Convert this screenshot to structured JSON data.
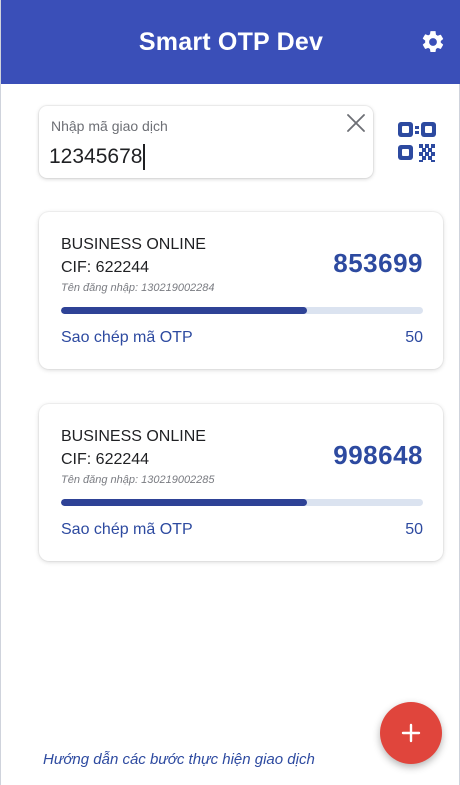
{
  "header": {
    "title": "Smart OTP Dev",
    "settings_icon": "gear-icon"
  },
  "transaction_input": {
    "label": "Nhập mã giao dịch",
    "value": "12345678",
    "clear_icon": "close-icon"
  },
  "qr_scanner": {
    "icon": "qr-code-icon"
  },
  "otp_cards": [
    {
      "service": "BUSINESS ONLINE",
      "cif": "CIF: 622244",
      "username": "Tên đăng nhập: 130219002284",
      "code": "853699",
      "copy_label": "Sao chép mã OTP",
      "seconds_left": "50",
      "progress_fraction": 0.68
    },
    {
      "service": "BUSINESS ONLINE",
      "cif": "CIF: 622244",
      "username": "Tên đăng nhập: 130219002285",
      "code": "998648",
      "copy_label": "Sao chép mã OTP",
      "seconds_left": "50",
      "progress_fraction": 0.68
    }
  ],
  "footer": {
    "guide_link": "Hướng dẫn các bước thực hiện giao dịch"
  },
  "fab": {
    "label": "+",
    "icon": "plus-icon"
  },
  "colors": {
    "header": "#3a4fb8",
    "primary_text": "#2d4aa0",
    "progress": "#2e4296",
    "fab": "#e0453c"
  }
}
